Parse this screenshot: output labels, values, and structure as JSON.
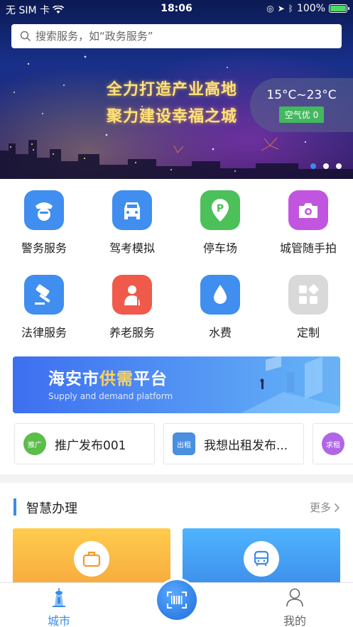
{
  "status_bar": {
    "carrier": "无 SIM 卡",
    "time": "18:06",
    "battery": "100%"
  },
  "search": {
    "placeholder": "搜索服务，如“政务服务”"
  },
  "banner": {
    "slogan_line1": "全力打造产业高地",
    "slogan_line2": "聚力建设幸福之城",
    "weather": {
      "temperature": "15°C~23°C",
      "air_quality": "空气优 0"
    },
    "carousel": {
      "count": 3,
      "active_index": 0
    }
  },
  "services": [
    {
      "id": "police",
      "label": "警务服务",
      "icon": "police-cap-icon",
      "color": "#3f8ef0"
    },
    {
      "id": "driving",
      "label": "驾考模拟",
      "icon": "car-icon",
      "color": "#3f8ef0"
    },
    {
      "id": "parking",
      "label": "停车场",
      "icon": "parking-pin-icon",
      "color": "#4cc15a"
    },
    {
      "id": "urban",
      "label": "城管随手拍",
      "icon": "camera-icon",
      "color": "#c255e0"
    },
    {
      "id": "law",
      "label": "法律服务",
      "icon": "gavel-icon",
      "color": "#3f8ef0"
    },
    {
      "id": "elderly",
      "label": "养老服务",
      "icon": "elder-icon",
      "color": "#ef5a4a"
    },
    {
      "id": "water",
      "label": "水费",
      "icon": "water-drop-icon",
      "color": "#3f8ef0"
    },
    {
      "id": "custom",
      "label": "定制",
      "icon": "customize-icon",
      "color": "#d9d9d9"
    }
  ],
  "promo": {
    "title_prefix": "海安市",
    "title_highlight": "供需",
    "title_suffix": "平台",
    "subtitle": "Supply and demand platform"
  },
  "posts": [
    {
      "badge": "推广",
      "badge_color": "#5bbd4a",
      "text": "推广发布001"
    },
    {
      "badge": "出租",
      "badge_color": "#4a8fe0",
      "text": "我想出租发布..."
    },
    {
      "badge": "求租",
      "badge_color": "#b066e6",
      "text": ""
    }
  ],
  "smart_section": {
    "title": "智慧办理",
    "more_label": "更多"
  },
  "tabs": {
    "city": "城市",
    "mine": "我的"
  },
  "colors": {
    "accent": "#3b8be8",
    "gold": "#ffd25a"
  }
}
